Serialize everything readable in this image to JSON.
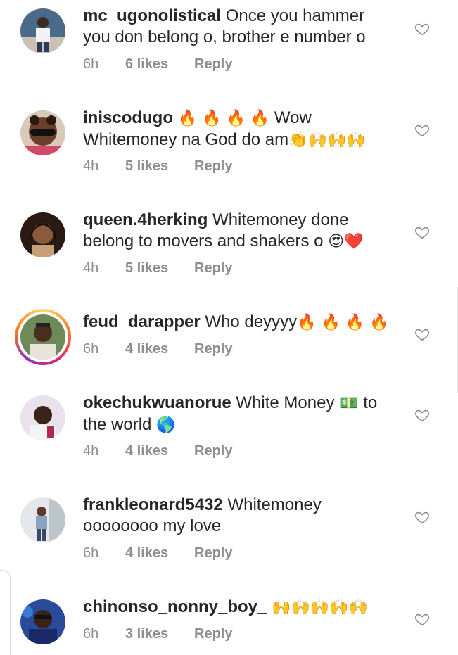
{
  "comments": [
    {
      "username": "mc_ugonolistical",
      "text_line1": "Once you hammer",
      "text_line2": "you don belong o, brother e  number o",
      "time": "6h",
      "likes": "6 likes",
      "reply": "Reply",
      "heart_icon": "heart-outline-icon"
    },
    {
      "username": "iniscodugo",
      "emoji_a": "🔥 🔥 🔥 🔥",
      "text_a": "Wow",
      "text_line2": "Whitemoney na God do am",
      "emoji_b": "👏🙌🙌🙌",
      "time": "4h",
      "likes": "5 likes",
      "reply": "Reply"
    },
    {
      "username": "queen.4herking",
      "text_line1": "Whitemoney done",
      "text_line2": "belong to movers and shakers o",
      "emoji_b": "😍❤️",
      "time": "4h",
      "likes": "5 likes",
      "reply": "Reply"
    },
    {
      "username": "feud_darapper",
      "text_line1": "Who deyyyy",
      "emoji_a": "🔥 🔥 🔥 🔥",
      "time": "6h",
      "likes": "4 likes",
      "reply": "Reply"
    },
    {
      "username": "okechukwuanorue",
      "text_line1": "White Money",
      "emoji_a": "💵",
      "text_after": "to",
      "text_line2": "the world",
      "emoji_b": "🌎",
      "time": "4h",
      "likes": "4 likes",
      "reply": "Reply"
    },
    {
      "username": "frankleonard5432",
      "text_line1": "Whitemoney",
      "text_line2": "oooooooo my love",
      "time": "6h",
      "likes": "4 likes",
      "reply": "Reply"
    },
    {
      "username": "chinonso_nonny_boy_",
      "emoji_a": "🙌🙌🙌🙌🙌",
      "time": "6h",
      "likes": "3 likes",
      "reply": "Reply"
    }
  ],
  "colors": {
    "text": "#262626",
    "meta": "#8e8e8e",
    "heart": "#8e8e8e"
  }
}
